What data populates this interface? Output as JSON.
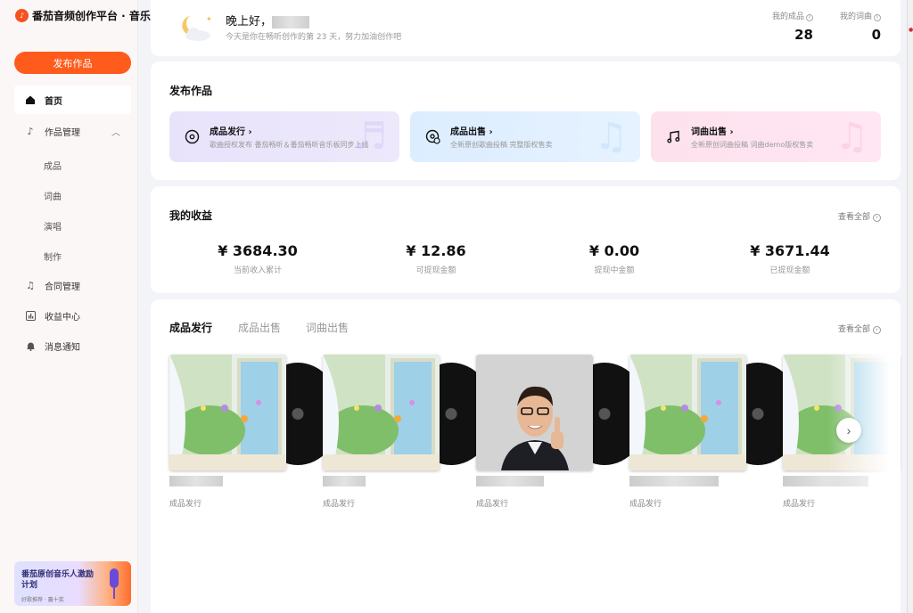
{
  "app": {
    "logo_text": "番茄音频创作平台 · 音乐",
    "logo_icon": "logo-icon"
  },
  "sidebar": {
    "publish_label": "发布作品",
    "items": [
      {
        "label": "首页",
        "icon": "home-icon",
        "active": true
      },
      {
        "label": "作品管理",
        "icon": "music-note-icon",
        "expanded": true
      },
      {
        "label": "成品"
      },
      {
        "label": "词曲"
      },
      {
        "label": "演唱"
      },
      {
        "label": "制作"
      },
      {
        "label": "合同管理",
        "icon": "music-notes-icon"
      },
      {
        "label": "收益中心",
        "icon": "bar-chart-icon"
      },
      {
        "label": "消息通知",
        "icon": "bell-icon"
      }
    ],
    "banner": {
      "title": "番茄原创音乐人激励计划",
      "subtitle": "好歌推荐 · 赢十奖"
    }
  },
  "greeting": {
    "title": "晚上好，",
    "subtitle": "今天是你在畅听创作的第 23 天，努力加油创作吧",
    "stats": [
      {
        "label": "我的成品",
        "value": "28"
      },
      {
        "label": "我的词曲",
        "value": "0"
      }
    ]
  },
  "publish": {
    "title": "发布作品",
    "cards": [
      {
        "title": "成品发行 ›",
        "desc": "歌曲授权发布 番茄畅听＆番茄畅听音乐板同步上线",
        "icon": "disc-icon"
      },
      {
        "title": "成品出售 ›",
        "desc": "全新原创歌曲投稿 完整版权售卖",
        "icon": "disc-refresh-icon"
      },
      {
        "title": "词曲出售 ›",
        "desc": "全新原创词曲投稿 词曲demo版权售卖",
        "icon": "music-note-icon"
      }
    ]
  },
  "income": {
    "title": "我的收益",
    "view_all": "查看全部",
    "items": [
      {
        "value": "¥ 3684.30",
        "label": "当前收入累计"
      },
      {
        "value": "¥ 12.86",
        "label": "可提现金额"
      },
      {
        "value": "¥ 0.00",
        "label": "提现中金额"
      },
      {
        "value": "¥ 3671.44",
        "label": "已提现金额"
      }
    ]
  },
  "works": {
    "tabs": [
      "成品发行",
      "成品出售",
      "词曲出售"
    ],
    "active_tab": 0,
    "view_all": "查看全部",
    "albums": [
      {
        "type": "成品发行",
        "cover": "window-butterfly-painting"
      },
      {
        "type": "成品发行",
        "cover": "window-butterfly-painting"
      },
      {
        "type": "成品发行",
        "cover": "man-thumbs-up-photo"
      },
      {
        "type": "成品发行",
        "cover": "window-butterfly-painting"
      },
      {
        "type": "成品发行",
        "cover": "window-butterfly-painting"
      }
    ]
  },
  "colors": {
    "accent": "#fe5b1c",
    "sidebar_bg": "#fbf7f6",
    "page_bg": "#f3f4f7"
  }
}
